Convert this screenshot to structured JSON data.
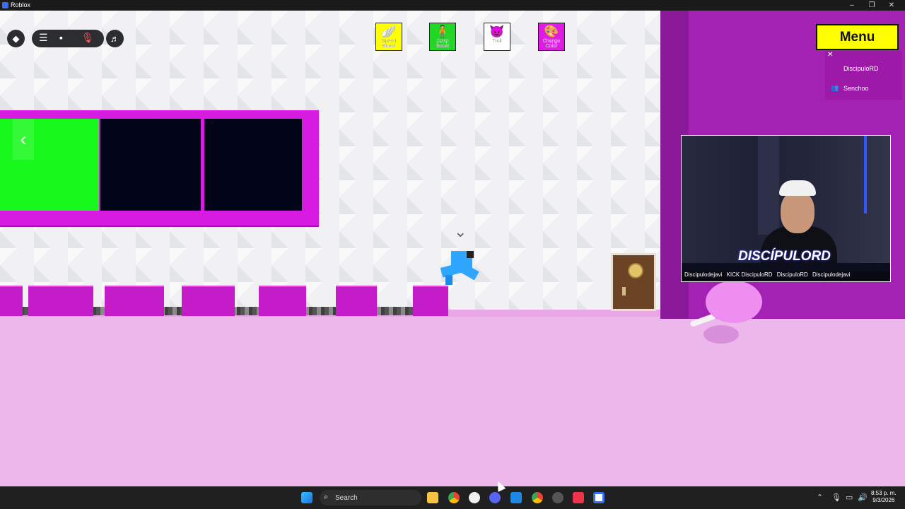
{
  "window": {
    "title": "Roblox",
    "controls": [
      "–",
      "❐",
      "✕"
    ]
  },
  "toolbar_left": {
    "icons": [
      "roblox-menu",
      "hamburger",
      "chat",
      "mic-muted",
      "music"
    ]
  },
  "tools": [
    {
      "label": "Speed Boost",
      "bg": "#ffff00",
      "glyph": "🪽"
    },
    {
      "label": "Jump Boost",
      "bg": "#23d627",
      "glyph": "🧍"
    },
    {
      "label": "Troll",
      "bg": "#ffffff",
      "glyph": "😈"
    },
    {
      "label": "Change Color",
      "bg": "#e11be6",
      "glyph": "🎨"
    }
  ],
  "menu": {
    "label": "Menu"
  },
  "players_panel": {
    "close": "✕",
    "players": [
      "DiscipuloRD",
      "Senchoo"
    ]
  },
  "webcam": {
    "brand": "DISCÍPULORD",
    "socials": [
      "Discipulodejavi",
      "KICK DiscipuloRD",
      "DiscipuloRD",
      "Discipulodejavi"
    ]
  },
  "taskbar": {
    "search_placeholder": "Search",
    "clock_time": "8:53 p. m.",
    "clock_date": "9/3/2026",
    "pinned": [
      "file-explorer",
      "chrome",
      "chatgpt",
      "discord",
      "bing",
      "chrome-2",
      "app-red",
      "music-red",
      "roblox"
    ]
  }
}
